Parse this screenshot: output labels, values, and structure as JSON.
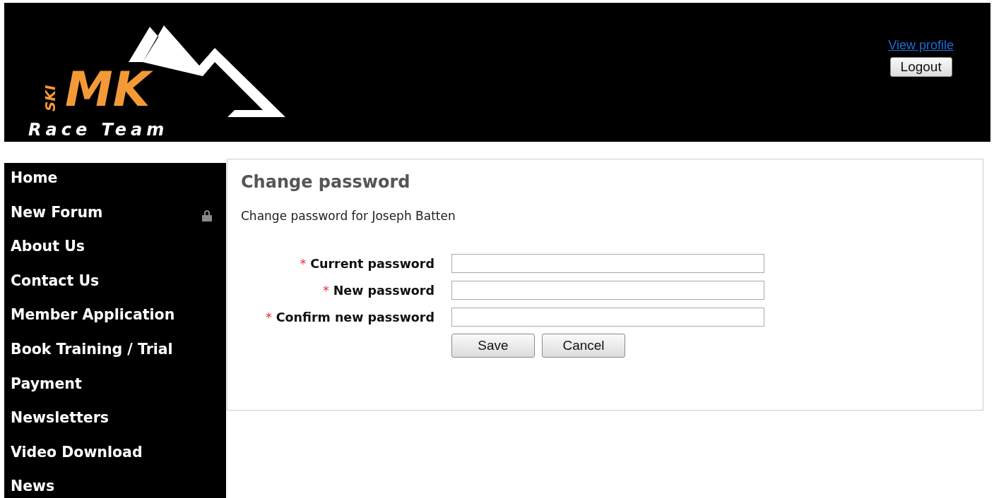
{
  "header": {
    "logo": {
      "small": "SKI",
      "big": "MK",
      "tagline": "Race Team"
    },
    "profile_link": "View profile",
    "logout_button": "Logout"
  },
  "sidebar": {
    "items": [
      {
        "label": "Home",
        "locked": false
      },
      {
        "label": "New Forum",
        "locked": true
      },
      {
        "label": "About Us",
        "locked": false
      },
      {
        "label": "Contact Us",
        "locked": false
      },
      {
        "label": "Member Application",
        "locked": false
      },
      {
        "label": "Book Training / Trial",
        "locked": false
      },
      {
        "label": "Payment",
        "locked": false
      },
      {
        "label": "Newsletters",
        "locked": false
      },
      {
        "label": "Video Download",
        "locked": false
      },
      {
        "label": "News",
        "locked": false
      }
    ]
  },
  "content": {
    "title": "Change password",
    "description": "Change password for Joseph Batten",
    "fields": [
      {
        "label": "Current password",
        "required_mark": "*"
      },
      {
        "label": "New password",
        "required_mark": "*"
      },
      {
        "label": "Confirm new password",
        "required_mark": "*"
      }
    ],
    "buttons": [
      "Save",
      "Cancel"
    ]
  }
}
